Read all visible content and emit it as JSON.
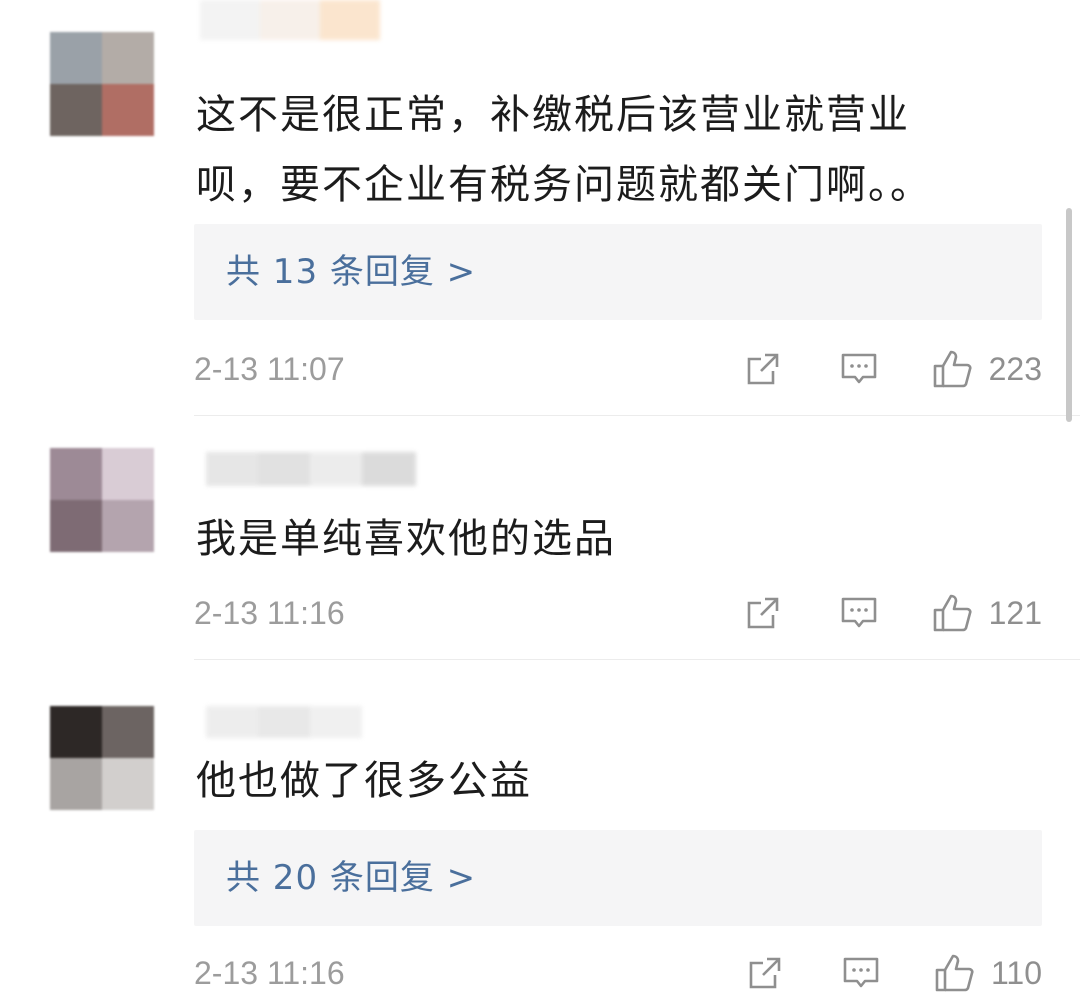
{
  "comments": [
    {
      "text_line1": "这不是很正常，补缴税后该营业就营业",
      "text_line2": "呗，要不企业有税务问题就都关门啊。。",
      "replies": "共 13 条回复 >",
      "time": "2-13 11:07",
      "likes": "223"
    },
    {
      "text_line1": "我是单纯喜欢他的选品",
      "time": "2-13 11:16",
      "likes": "121"
    },
    {
      "text_line1": "他也做了很多公益",
      "replies": "共 20 条回复 >",
      "time": "2-13 11:16",
      "likes": "110"
    }
  ],
  "icons": {
    "share": "share-icon",
    "comment": "comment-icon",
    "like": "thumbs-up-icon"
  },
  "colors": {
    "reply_link": "#4a6f9c",
    "meta_text": "#9c9c9c",
    "reply_bg": "#f5f5f6"
  }
}
